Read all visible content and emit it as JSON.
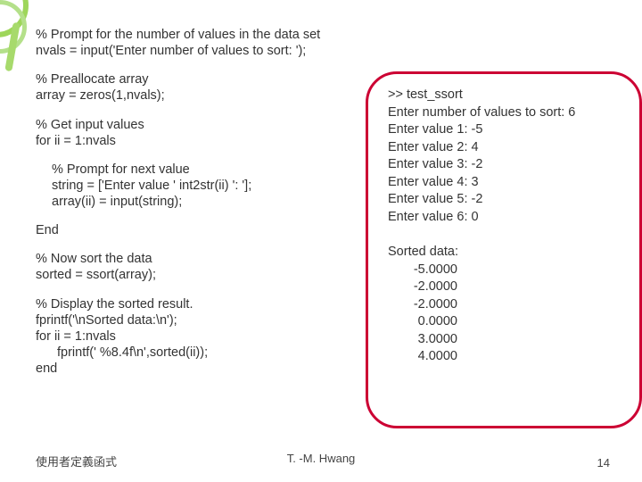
{
  "code": {
    "c1a": "% Prompt for the number of values in the data set",
    "c1b": "nvals = input('Enter number of values to sort:  ');",
    "c2a": "% Preallocate array",
    "c2b": "array = zeros(1,nvals);",
    "c3a": "% Get input values",
    "c3b": "for ii = 1:nvals",
    "c4a": "% Prompt for next value",
    "c4b": "string = ['Enter value ' int2str(ii) ':  '];",
    "c4c": "array(ii) = input(string);",
    "c5": "End",
    "c6a": "% Now sort the data",
    "c6b": "sorted = ssort(array);",
    "c7a": "% Display the sorted result.",
    "c7b": "fprintf('\\nSorted data:\\n');",
    "c7c": "for ii = 1:nvals",
    "c7d": "fprintf(' %8.4f\\n',sorted(ii));",
    "c7e": "end"
  },
  "output": {
    "l1": ">> test_ssort",
    "l2": "Enter number of values to sort:  6",
    "p": [
      {
        "label": "Enter value 1:  ",
        "val": "-5"
      },
      {
        "label": "Enter value 2:  ",
        "val": "4"
      },
      {
        "label": "Enter value 3:  ",
        "val": "-2"
      },
      {
        "label": "Enter value 4:  ",
        "val": "3"
      },
      {
        "label": "Enter value 5:  ",
        "val": "-2"
      },
      {
        "label": "Enter value 6:  ",
        "val": "0"
      }
    ],
    "sorted_header": "Sorted data:",
    "sorted": [
      "-5.0000",
      "-2.0000",
      "-2.0000",
      "0.0000",
      "3.0000",
      "4.0000"
    ]
  },
  "footer": {
    "left": "使用者定義函式",
    "center": "T. -M. Hwang",
    "right": "14"
  }
}
